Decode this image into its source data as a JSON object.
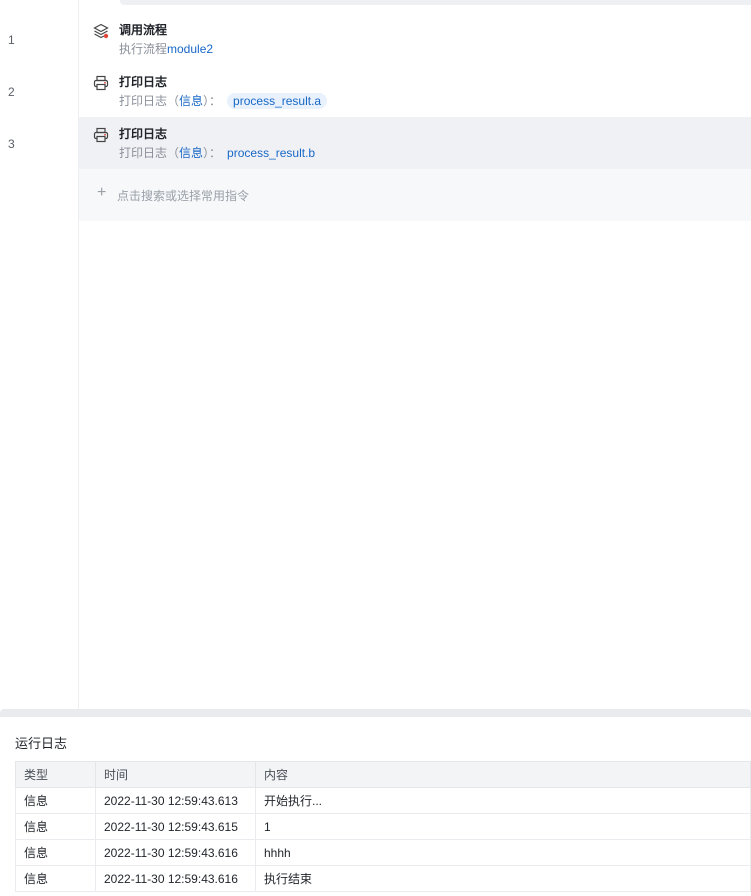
{
  "editor": {
    "line_numbers": [
      "1",
      "2",
      "3"
    ],
    "rows": [
      {
        "title": "调用流程",
        "desc_prefix": "执行流程",
        "desc_value": "module2",
        "icon": "layers-icon"
      },
      {
        "title": "打印日志",
        "desc_prefix": "打印日志（",
        "level": "信息",
        "desc_suffix": "）：",
        "value": "process_result.a",
        "icon": "printer-icon"
      },
      {
        "title": "打印日志",
        "desc_prefix": "打印日志（",
        "level": "信息",
        "desc_suffix": "）：",
        "value": "process_result.b",
        "icon": "printer-icon"
      }
    ],
    "add_placeholder": "点击搜索或选择常用指令"
  },
  "log_panel": {
    "title": "运行日志",
    "columns": [
      "类型",
      "时间",
      "内容"
    ],
    "rows": [
      {
        "type": "信息",
        "time": "2022-11-30 12:59:43.613",
        "content": "开始执行..."
      },
      {
        "type": "信息",
        "time": "2022-11-30 12:59:43.615",
        "content": "1"
      },
      {
        "type": "信息",
        "time": "2022-11-30 12:59:43.616",
        "content": "hhhh"
      },
      {
        "type": "信息",
        "time": "2022-11-30 12:59:43.616",
        "content": "执行结束"
      }
    ]
  },
  "colors": {
    "accent": "#1868c7",
    "chip_bg": "#e8f1fc",
    "selected_row": "#f0f1f4"
  }
}
